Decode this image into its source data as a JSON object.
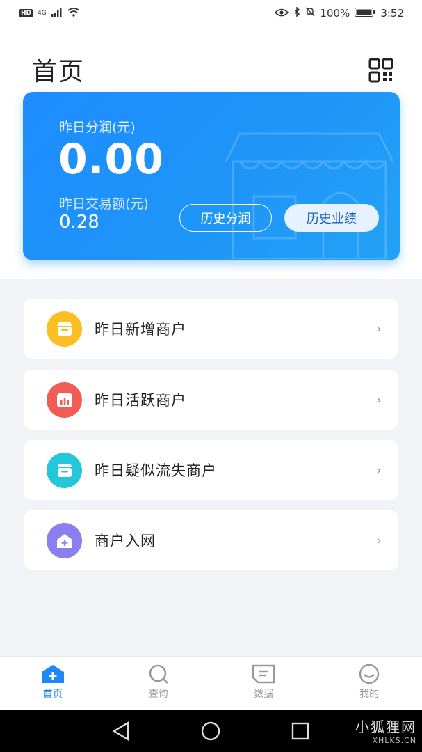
{
  "status": {
    "network": "4G",
    "battery": "100%",
    "time": "3:52",
    "hd": "HD"
  },
  "page": {
    "title": "首页"
  },
  "card": {
    "profit_label": "昨日分润(元)",
    "profit_value": "0.00",
    "volume_label": "昨日交易额(元)",
    "volume_value": "0.28",
    "history_profit_btn": "历史分润",
    "history_perf_btn": "历史业绩",
    "gradient_start": "#1f8cff",
    "gradient_end": "#23a2f6"
  },
  "menu": [
    {
      "label": "昨日新增商户",
      "icon": "store-icon",
      "color": "#fbbf24"
    },
    {
      "label": "昨日活跃商户",
      "icon": "bar-chart-icon",
      "color": "#f25c54"
    },
    {
      "label": "昨日疑似流失商户",
      "icon": "store-icon",
      "color": "#26c6da"
    },
    {
      "label": "商户入网",
      "icon": "house-plus-icon",
      "color": "#8b7ff0"
    }
  ],
  "tabs": [
    {
      "label": "首页",
      "icon": "home-icon",
      "active": true
    },
    {
      "label": "查询",
      "icon": "search-icon",
      "active": false
    },
    {
      "label": "数据",
      "icon": "document-icon",
      "active": false
    },
    {
      "label": "我的",
      "icon": "smile-icon",
      "active": false
    }
  ],
  "watermark": {
    "cn": "小狐狸网",
    "en": "XHLKS.CN"
  },
  "colors": {
    "accent": "#1e88f5",
    "background": "#f2f3f7"
  }
}
